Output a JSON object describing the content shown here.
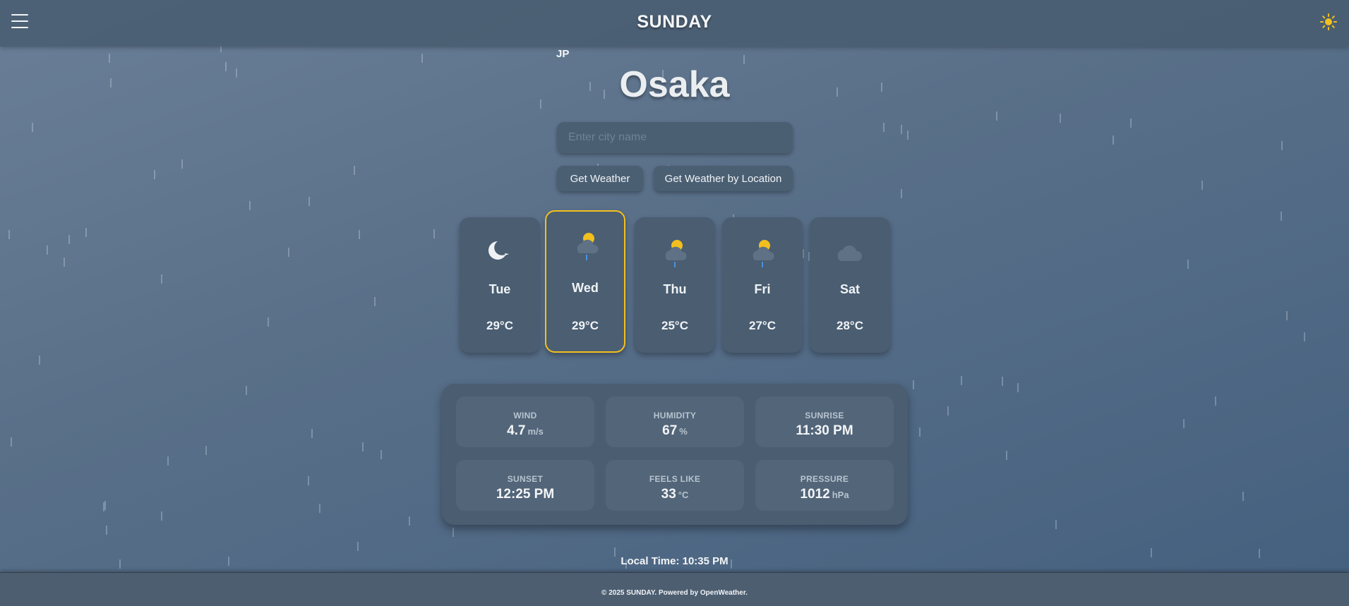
{
  "header": {
    "menu_icon": "hamburger-menu-icon",
    "brand": "SUNDAY",
    "theme_icon": "sun-icon",
    "theme_color": "#f2c01e"
  },
  "location": {
    "country": "JP",
    "city": "Osaka"
  },
  "search": {
    "placeholder": "Enter city name",
    "value": ""
  },
  "buttons": {
    "get_weather": "Get Weather",
    "get_weather_location": "Get Weather by Location"
  },
  "forecast": [
    {
      "day": "Tue",
      "temp": "29°C",
      "icon": "moon-icon",
      "selected": false
    },
    {
      "day": "Wed",
      "temp": "29°C",
      "icon": "cloud-sun-rain-icon",
      "selected": true
    },
    {
      "day": "Thu",
      "temp": "25°C",
      "icon": "cloud-sun-rain-icon",
      "selected": false
    },
    {
      "day": "Fri",
      "temp": "27°C",
      "icon": "cloud-sun-rain-icon",
      "selected": false
    },
    {
      "day": "Sat",
      "temp": "28°C",
      "icon": "cloud-icon",
      "selected": false
    }
  ],
  "details": {
    "wind": {
      "label": "WIND",
      "value": "4.7",
      "unit": "m/s"
    },
    "humidity": {
      "label": "HUMIDITY",
      "value": "67",
      "unit": "%"
    },
    "sunrise": {
      "label": "SUNRISE",
      "value": "11:30 PM",
      "unit": ""
    },
    "sunset": {
      "label": "SUNSET",
      "value": "12:25 PM",
      "unit": ""
    },
    "feels_like": {
      "label": "FEELS LIKE",
      "value": "33",
      "unit": "°C"
    },
    "pressure": {
      "label": "PRESSURE",
      "value": "1012",
      "unit": "hPa"
    }
  },
  "local_time": "Local Time: 10:35 PM",
  "footer": "© 2025 SUNDAY. Powered by OpenWeather.",
  "colors": {
    "accent": "#f2c01e",
    "card": "#4a5d71",
    "background": "#5a7089"
  }
}
